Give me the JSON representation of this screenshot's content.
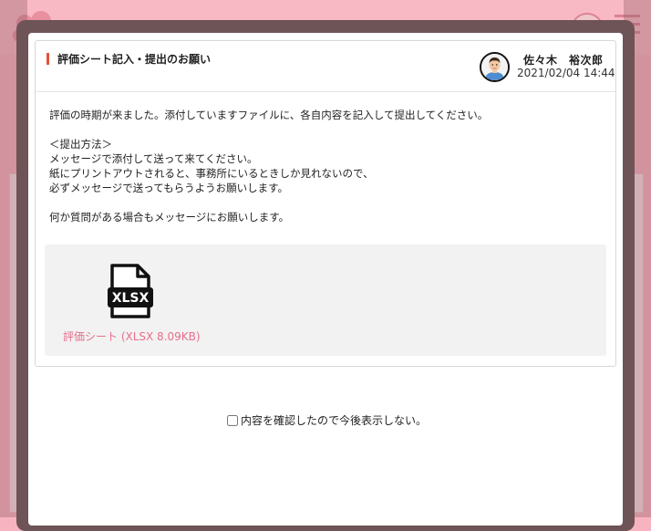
{
  "notice": {
    "title": "評価シート記入・提出のお願い",
    "author_name": "佐々木　裕次郎",
    "date": "2021/02/04 14:44",
    "body_lines": [
      "評価の時期が来ました。添付していますファイルに、各自内容を記入して提出してください。",
      "",
      "＜提出方法＞",
      "メッセージで添付して送って来てください。",
      "紙にプリントアウトされると、事務所にいるときしか見れないので、",
      "必ずメッセージで送ってもらうようお願いします。",
      "",
      "何か質問がある場合もメッセージにお願いします。"
    ],
    "attachment": {
      "icon_label": "XLSX",
      "link_text": "評価シート (XLSX 8.09KB)"
    }
  },
  "confirm": {
    "label": "内容を確認したので今後表示しない。"
  },
  "colors": {
    "accent": "#e0533e",
    "link": "#e86f8c",
    "background": "#f7b3bf"
  }
}
